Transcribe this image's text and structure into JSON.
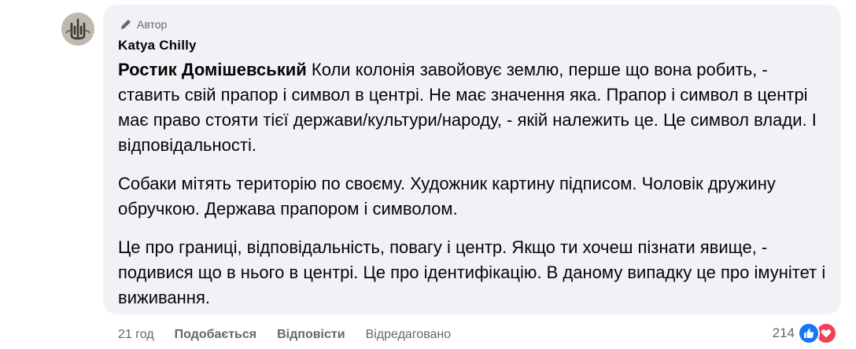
{
  "comment": {
    "author_badge": "Автор",
    "author_name": "Katya Chilly",
    "mention": "Ростик Домішевський",
    "paragraph1_rest": " Коли колонія завойовує землю, перше що вона робить, - ставить свій прапор і символ в центрі. Не має значення яка. Прапор і символ в центрі має право стояти тієї держави/культури/народу, - якій належить це. Це символ влади. І відповідальності.",
    "paragraph2": "Собаки мітять територію по своєму. Художник картину підписом. Чоловік дружину обручкою. Держава прапором і символом.",
    "paragraph3": "Це про границі, відповідальність, повагу і центр. Якщо ти хочеш пізнати явище, - подивися що в нього в центрі. Це про ідентифікацію. В даному випадку це про імунітет і виживання."
  },
  "actions": {
    "time": "21 год",
    "like_label": "Подобається",
    "reply_label": "Відповісти",
    "edited_label": "Відредаговано"
  },
  "reactions": {
    "count": "214",
    "types": [
      "like-icon",
      "love-icon"
    ]
  },
  "colors": {
    "bubble": "#f0f2f5",
    "secondary_text": "#65676b",
    "like": "#1877f2",
    "love": "#f33e58"
  }
}
